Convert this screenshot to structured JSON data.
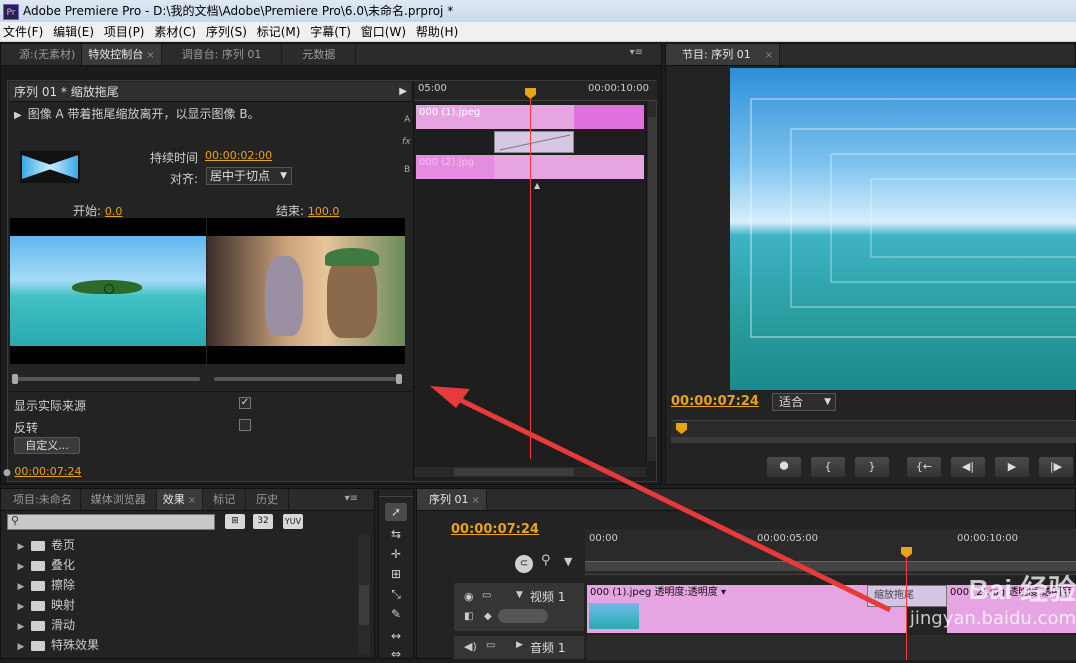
{
  "window": {
    "title": "Adobe Premiere Pro - D:\\我的文档\\Adobe\\Premiere Pro\\6.0\\未命名.prproj *",
    "logo": "Pr"
  },
  "menu": [
    "文件(F)",
    "编辑(E)",
    "项目(P)",
    "素材(C)",
    "序列(S)",
    "标记(M)",
    "字幕(T)",
    "窗口(W)",
    "帮助(H)"
  ],
  "top_left": {
    "tabs": [
      {
        "label": "源:(无素材)",
        "active": false
      },
      {
        "label": "特效控制台",
        "active": true,
        "close": "×"
      },
      {
        "label": "调音台: 序列 01",
        "active": false
      },
      {
        "label": "元数据",
        "active": false
      }
    ],
    "header": "序列 01 * 缩放拖尾",
    "desc": "图像 A 带着拖尾缩放离开，以显示图像 B。",
    "duration_label": "持续时间",
    "duration_value": "00:00:02:00",
    "align_label": "对齐:",
    "align_value": "居中于切点",
    "start_label": "开始:",
    "start_value": "0.0",
    "end_label": "结束:",
    "end_value": "100.0",
    "show_source_label": "显示实际来源",
    "show_source_checked": "✓",
    "reverse_label": "反转",
    "custom_button": "自定义...",
    "timecode": "00:00:07:24",
    "mini_timeline": {
      "ruler_left": "05:00",
      "ruler_right": "00:00:10:00",
      "clip_a": "000 (1).jpeg",
      "clip_b": "000 (2).jpg",
      "track_a": "A",
      "track_fx": "fx",
      "track_b": "B"
    }
  },
  "program_monitor": {
    "tabs": [
      {
        "label": "节目: 序列 01",
        "active": true,
        "close": "×"
      }
    ],
    "timecode": "00:00:07:24",
    "fit_label": "适合",
    "controls": [
      "⯃",
      "{",
      "}",
      "{←",
      "◀|",
      "▶",
      "|▶"
    ]
  },
  "project_panel": {
    "tabs": [
      {
        "label": "项目:未命名",
        "active": false
      },
      {
        "label": "媒体浏览器",
        "active": false
      },
      {
        "label": "效果",
        "active": true,
        "close": "×"
      },
      {
        "label": "标记",
        "active": false
      },
      {
        "label": "历史",
        "active": false
      }
    ],
    "icon_labels": [
      "32",
      "YUV"
    ],
    "items": [
      "卷页",
      "叠化",
      "擦除",
      "映射",
      "滑动",
      "特殊效果"
    ]
  },
  "tools": [
    "selection-tool",
    "track-select-tool",
    "ripple-edit-tool",
    "rolling-edit-tool",
    "rate-stretch-tool",
    "razor-tool",
    "slip-tool",
    "slide-tool"
  ],
  "sequence": {
    "tabs": [
      {
        "label": "序列 01",
        "active": true,
        "close": "×"
      }
    ],
    "timecode": "00:00:07:24",
    "ruler": [
      "00:00",
      "00:00:05:00",
      "00:00:10:00"
    ],
    "video_track": "视频 1",
    "audio_track": "音频 1",
    "clip1_label": "000 (1).jpeg",
    "clip1_effect": "透明度:透明度 ▾",
    "transition_label": "缩放拖尾",
    "clip2_label": "000 (2).jpg",
    "clip2_effect": "透明度:透明度"
  },
  "watermark": {
    "text": "Bai 经验",
    "url": "jingyan.baidu.com"
  },
  "colors": {
    "accent": "#e8a317",
    "clip": "#e7a4e3",
    "playhead": "#ff3b3b",
    "arrow": "#e83a3a"
  }
}
